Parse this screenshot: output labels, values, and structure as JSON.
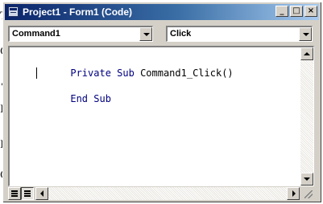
{
  "window": {
    "title": "Project1 - Form1 (Code)",
    "minimize_label": "_",
    "maximize_label": "□",
    "close_label": "×"
  },
  "toolbar": {
    "object_combo": "Command1",
    "procedure_combo": "Click"
  },
  "code": {
    "lines": [
      [
        {
          "kind": "keyword",
          "text": "Private Sub "
        },
        {
          "kind": "ident",
          "text": "Command1_Click()"
        }
      ],
      [],
      [
        {
          "kind": "keyword",
          "text": "End Sub"
        }
      ]
    ]
  },
  "background_fragments": [
    "T",
    "O",
    "•",
    "I",
    "I",
    "O"
  ],
  "colors": {
    "keyword": "#000080",
    "title_start": "#0a246a",
    "title_end": "#a6caf0",
    "chrome": "#d4d0c8"
  },
  "icons": {
    "app": "vb-code-window-icon",
    "minimize": "minimize-icon",
    "maximize": "maximize-icon",
    "close": "close-icon",
    "dropdown": "chevron-down-icon",
    "procedure_view": "procedure-view-icon",
    "full_module_view": "full-module-view-icon",
    "resize": "resize-grip-icon"
  }
}
